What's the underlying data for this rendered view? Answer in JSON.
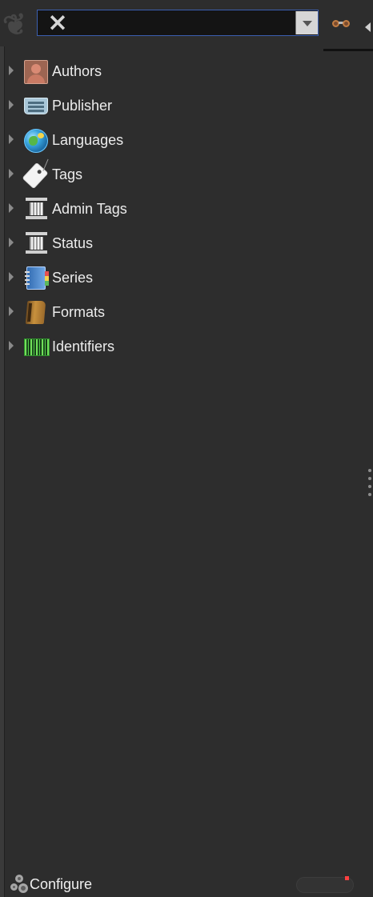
{
  "search": {
    "value": "",
    "placeholder": ""
  },
  "tree": {
    "items": [
      {
        "label": "Authors",
        "icon": "author-portrait-icon"
      },
      {
        "label": "Publisher",
        "icon": "typewriter-icon"
      },
      {
        "label": "Languages",
        "icon": "globe-icon"
      },
      {
        "label": "Tags",
        "icon": "tag-icon"
      },
      {
        "label": "Admin Tags",
        "icon": "column-icon"
      },
      {
        "label": "Status",
        "icon": "column-icon"
      },
      {
        "label": "Series",
        "icon": "notebook-icon"
      },
      {
        "label": "Formats",
        "icon": "book-icon"
      },
      {
        "label": "Identifiers",
        "icon": "barcode-icon"
      }
    ]
  },
  "footer": {
    "configure_label": "Configure",
    "configure_icon": "gear-icon"
  },
  "colors": {
    "background": "#2d2d2d",
    "search_background": "#141414",
    "focus_border": "#3b5fb0",
    "text": "#ececec"
  }
}
